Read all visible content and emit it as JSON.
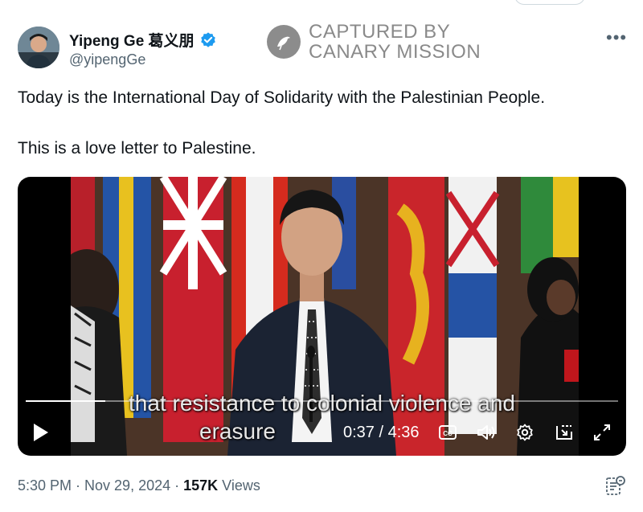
{
  "tweet": {
    "author_name": "Yipeng Ge 葛义朋",
    "handle": "@yipengGe",
    "text_line1": "Today is the International Day of Solidarity with the Palestinian People.",
    "text_line2": "This is a love letter to Palestine.",
    "timestamp": "5:30 PM · Nov 29, 2024 · ",
    "views_count": "157K",
    "views_label": "Views"
  },
  "watermark": {
    "line1": "CAPTURED BY",
    "line2": "CANARY MISSION"
  },
  "video": {
    "subtitle_line1": "that resistance to colonial violence and",
    "subtitle_line2": "erasure",
    "time": "0:37 / 4:36",
    "progress": 0.134,
    "cc_label": "CC"
  },
  "colors": {
    "verified": "#1d9bf0",
    "text": "#0f1419",
    "secondary": "#536471"
  }
}
